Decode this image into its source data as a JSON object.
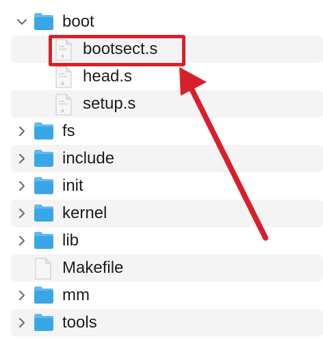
{
  "rows": [
    {
      "label": "boot",
      "type": "folder",
      "expanded": true,
      "chevron": "chevron-down-icon",
      "alt": false
    },
    {
      "label": "bootsect.s",
      "type": "file-s",
      "alt": true
    },
    {
      "label": "head.s",
      "type": "file-s",
      "alt": false
    },
    {
      "label": "setup.s",
      "type": "file-s",
      "alt": true
    },
    {
      "label": "fs",
      "type": "folder",
      "chevron": "chevron-right-icon",
      "alt": false
    },
    {
      "label": "include",
      "type": "folder",
      "chevron": "chevron-right-icon",
      "alt": true
    },
    {
      "label": "init",
      "type": "folder",
      "chevron": "chevron-right-icon",
      "alt": false
    },
    {
      "label": "kernel",
      "type": "folder",
      "chevron": "chevron-right-icon",
      "alt": true
    },
    {
      "label": "lib",
      "type": "folder",
      "chevron": "chevron-right-icon",
      "alt": false
    },
    {
      "label": "Makefile",
      "type": "file-plain",
      "alt": true
    },
    {
      "label": "mm",
      "type": "folder",
      "chevron": "chevron-right-icon",
      "alt": false
    },
    {
      "label": "tools",
      "type": "folder",
      "chevron": "chevron-right-icon",
      "alt": true
    }
  ],
  "file_badge": ".s",
  "colors": {
    "folder_body": "#3aa6e8",
    "folder_tab": "#62baf0",
    "annotation_red": "#d8202a"
  }
}
